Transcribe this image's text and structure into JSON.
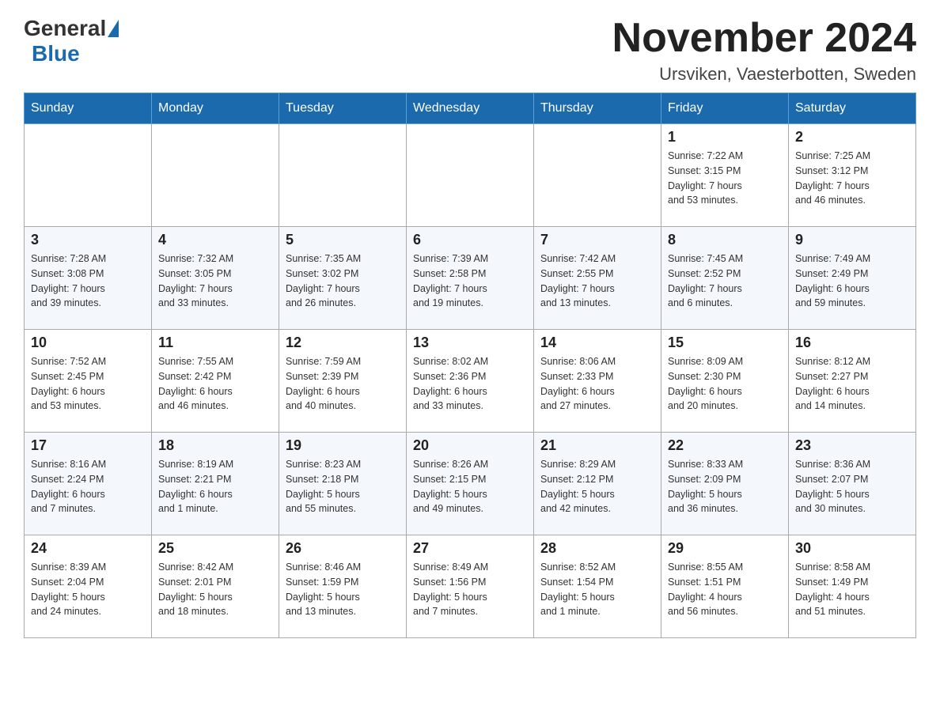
{
  "header": {
    "logo_general": "General",
    "logo_blue": "Blue",
    "month_title": "November 2024",
    "location": "Ursviken, Vaesterbotten, Sweden"
  },
  "days_of_week": [
    "Sunday",
    "Monday",
    "Tuesday",
    "Wednesday",
    "Thursday",
    "Friday",
    "Saturday"
  ],
  "weeks": [
    [
      {
        "day": "",
        "info": ""
      },
      {
        "day": "",
        "info": ""
      },
      {
        "day": "",
        "info": ""
      },
      {
        "day": "",
        "info": ""
      },
      {
        "day": "",
        "info": ""
      },
      {
        "day": "1",
        "info": "Sunrise: 7:22 AM\nSunset: 3:15 PM\nDaylight: 7 hours\nand 53 minutes."
      },
      {
        "day": "2",
        "info": "Sunrise: 7:25 AM\nSunset: 3:12 PM\nDaylight: 7 hours\nand 46 minutes."
      }
    ],
    [
      {
        "day": "3",
        "info": "Sunrise: 7:28 AM\nSunset: 3:08 PM\nDaylight: 7 hours\nand 39 minutes."
      },
      {
        "day": "4",
        "info": "Sunrise: 7:32 AM\nSunset: 3:05 PM\nDaylight: 7 hours\nand 33 minutes."
      },
      {
        "day": "5",
        "info": "Sunrise: 7:35 AM\nSunset: 3:02 PM\nDaylight: 7 hours\nand 26 minutes."
      },
      {
        "day": "6",
        "info": "Sunrise: 7:39 AM\nSunset: 2:58 PM\nDaylight: 7 hours\nand 19 minutes."
      },
      {
        "day": "7",
        "info": "Sunrise: 7:42 AM\nSunset: 2:55 PM\nDaylight: 7 hours\nand 13 minutes."
      },
      {
        "day": "8",
        "info": "Sunrise: 7:45 AM\nSunset: 2:52 PM\nDaylight: 7 hours\nand 6 minutes."
      },
      {
        "day": "9",
        "info": "Sunrise: 7:49 AM\nSunset: 2:49 PM\nDaylight: 6 hours\nand 59 minutes."
      }
    ],
    [
      {
        "day": "10",
        "info": "Sunrise: 7:52 AM\nSunset: 2:45 PM\nDaylight: 6 hours\nand 53 minutes."
      },
      {
        "day": "11",
        "info": "Sunrise: 7:55 AM\nSunset: 2:42 PM\nDaylight: 6 hours\nand 46 minutes."
      },
      {
        "day": "12",
        "info": "Sunrise: 7:59 AM\nSunset: 2:39 PM\nDaylight: 6 hours\nand 40 minutes."
      },
      {
        "day": "13",
        "info": "Sunrise: 8:02 AM\nSunset: 2:36 PM\nDaylight: 6 hours\nand 33 minutes."
      },
      {
        "day": "14",
        "info": "Sunrise: 8:06 AM\nSunset: 2:33 PM\nDaylight: 6 hours\nand 27 minutes."
      },
      {
        "day": "15",
        "info": "Sunrise: 8:09 AM\nSunset: 2:30 PM\nDaylight: 6 hours\nand 20 minutes."
      },
      {
        "day": "16",
        "info": "Sunrise: 8:12 AM\nSunset: 2:27 PM\nDaylight: 6 hours\nand 14 minutes."
      }
    ],
    [
      {
        "day": "17",
        "info": "Sunrise: 8:16 AM\nSunset: 2:24 PM\nDaylight: 6 hours\nand 7 minutes."
      },
      {
        "day": "18",
        "info": "Sunrise: 8:19 AM\nSunset: 2:21 PM\nDaylight: 6 hours\nand 1 minute."
      },
      {
        "day": "19",
        "info": "Sunrise: 8:23 AM\nSunset: 2:18 PM\nDaylight: 5 hours\nand 55 minutes."
      },
      {
        "day": "20",
        "info": "Sunrise: 8:26 AM\nSunset: 2:15 PM\nDaylight: 5 hours\nand 49 minutes."
      },
      {
        "day": "21",
        "info": "Sunrise: 8:29 AM\nSunset: 2:12 PM\nDaylight: 5 hours\nand 42 minutes."
      },
      {
        "day": "22",
        "info": "Sunrise: 8:33 AM\nSunset: 2:09 PM\nDaylight: 5 hours\nand 36 minutes."
      },
      {
        "day": "23",
        "info": "Sunrise: 8:36 AM\nSunset: 2:07 PM\nDaylight: 5 hours\nand 30 minutes."
      }
    ],
    [
      {
        "day": "24",
        "info": "Sunrise: 8:39 AM\nSunset: 2:04 PM\nDaylight: 5 hours\nand 24 minutes."
      },
      {
        "day": "25",
        "info": "Sunrise: 8:42 AM\nSunset: 2:01 PM\nDaylight: 5 hours\nand 18 minutes."
      },
      {
        "day": "26",
        "info": "Sunrise: 8:46 AM\nSunset: 1:59 PM\nDaylight: 5 hours\nand 13 minutes."
      },
      {
        "day": "27",
        "info": "Sunrise: 8:49 AM\nSunset: 1:56 PM\nDaylight: 5 hours\nand 7 minutes."
      },
      {
        "day": "28",
        "info": "Sunrise: 8:52 AM\nSunset: 1:54 PM\nDaylight: 5 hours\nand 1 minute."
      },
      {
        "day": "29",
        "info": "Sunrise: 8:55 AM\nSunset: 1:51 PM\nDaylight: 4 hours\nand 56 minutes."
      },
      {
        "day": "30",
        "info": "Sunrise: 8:58 AM\nSunset: 1:49 PM\nDaylight: 4 hours\nand 51 minutes."
      }
    ]
  ]
}
